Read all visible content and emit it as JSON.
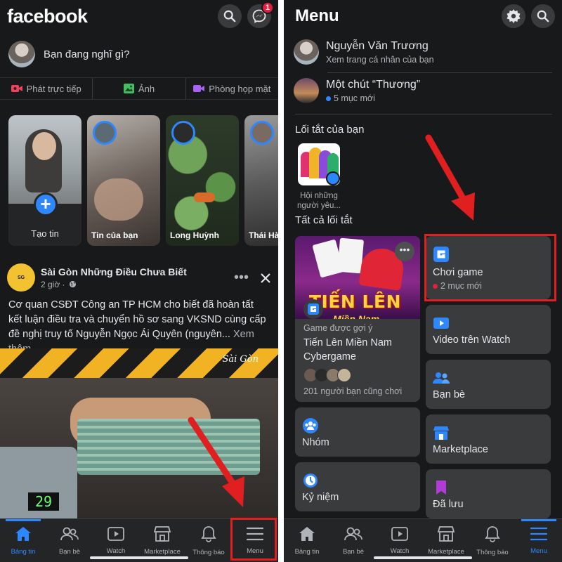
{
  "left": {
    "logo": "facebook",
    "messenger_badge": "1",
    "composer": {
      "placeholder": "Bạn đang nghĩ gì?"
    },
    "composer_actions": [
      {
        "label": "Phát trực tiếp",
        "icon": "live-video-icon",
        "color": "#f3425f"
      },
      {
        "label": "Ảnh",
        "icon": "photo-icon",
        "color": "#45bd62"
      },
      {
        "label": "Phòng họp mặt",
        "icon": "room-video-icon",
        "color": "#a863f5"
      }
    ],
    "stories": [
      {
        "label": "Tạo tin",
        "type": "create"
      },
      {
        "label": "Tin của bạn"
      },
      {
        "label": "Long Huỳnh"
      },
      {
        "label": "Thái Hà"
      }
    ],
    "post": {
      "page_name": "Sài Gòn Những Điều Chưa Biết",
      "time": "2 giờ ·",
      "text": "Cơ quan CSĐT Công an TP HCM cho biết đã hoàn tất kết luận điều tra và chuyển hồ sơ sang VKSND cùng cấp đề nghị truy tố Nguyễn Ngọc Ái Quyên (nguyên...",
      "see_more": "Xem thêm",
      "watermark": "Sài Gòn",
      "counter": "29"
    },
    "tabs": [
      {
        "label": "Bảng tin",
        "icon": "home-icon",
        "active": true
      },
      {
        "label": "Bạn bè",
        "icon": "friends-icon",
        "active": false
      },
      {
        "label": "Watch",
        "icon": "watch-icon",
        "active": false
      },
      {
        "label": "Marketplace",
        "icon": "marketplace-icon",
        "active": false
      },
      {
        "label": "Thông báo",
        "icon": "bell-icon",
        "active": false
      },
      {
        "label": "Menu",
        "icon": "menu-icon",
        "active": false
      }
    ]
  },
  "right": {
    "title": "Menu",
    "profile": {
      "name": "Nguyễn Văn Trương",
      "sub": "Xem trang cá nhân của bạn"
    },
    "page": {
      "name": "Một chút “Thương”",
      "sub": "5 mục mới"
    },
    "shortcuts_title": "Lối tắt của bạn",
    "shortcut": {
      "label": "Hội những người yêu..."
    },
    "all_shortcuts_title": "Tất cả lối tắt",
    "game_card": {
      "banner_title": "TIẾN LÊN",
      "banner_sub": "Miền Nam",
      "caption": "Game được gợi ý",
      "name": "Tiến Lên Miền Nam Cybergame",
      "friends": "201 người bạn cũng chơi"
    },
    "cards": {
      "games": {
        "label": "Chơi game",
        "sub": "2 mục mới",
        "icon": "game-icon"
      },
      "watch": {
        "label": "Video trên Watch",
        "icon": "watch-video-icon"
      },
      "friends": {
        "label": "Bạn bè",
        "icon": "friends-icon"
      },
      "groups": {
        "label": "Nhóm",
        "icon": "groups-icon"
      },
      "marketplace": {
        "label": "Marketplace",
        "icon": "marketplace-icon"
      },
      "memories": {
        "label": "Kỷ niệm",
        "icon": "memories-icon"
      },
      "saved": {
        "label": "Đã lưu",
        "icon": "saved-icon"
      }
    },
    "tabs": [
      {
        "label": "Bảng tin",
        "icon": "home-icon",
        "active": false
      },
      {
        "label": "Bạn bè",
        "icon": "friends-icon",
        "active": false
      },
      {
        "label": "Watch",
        "icon": "watch-icon",
        "active": false
      },
      {
        "label": "Marketplace",
        "icon": "marketplace-icon",
        "active": false
      },
      {
        "label": "Thông báo",
        "icon": "bell-icon",
        "active": false
      },
      {
        "label": "Menu",
        "icon": "menu-icon",
        "active": true
      }
    ]
  },
  "colors": {
    "accent": "#2d88ff",
    "highlight": "#e02020",
    "background": "#18191a",
    "card": "#3a3b3c"
  }
}
